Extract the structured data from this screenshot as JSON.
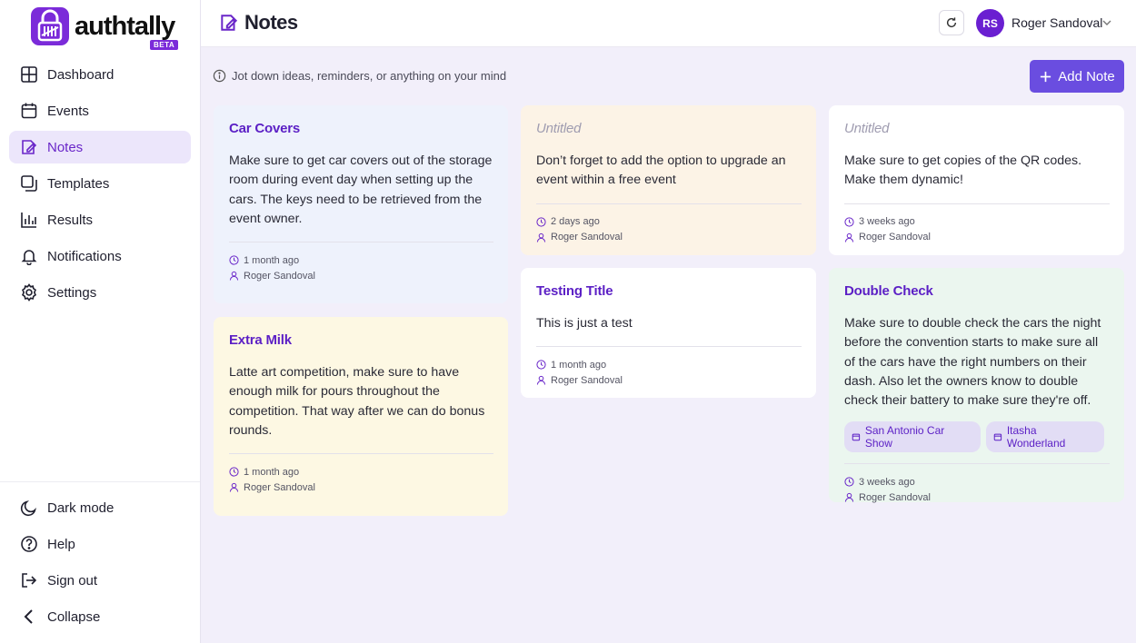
{
  "brand": {
    "name": "authtally",
    "badge": "BETA"
  },
  "nav": {
    "items": [
      {
        "label": "Dashboard",
        "icon": "dashboard-icon"
      },
      {
        "label": "Events",
        "icon": "calendar-icon"
      },
      {
        "label": "Notes",
        "icon": "note-icon",
        "active": true
      },
      {
        "label": "Templates",
        "icon": "templates-icon"
      },
      {
        "label": "Results",
        "icon": "chart-icon"
      },
      {
        "label": "Notifications",
        "icon": "bell-icon"
      },
      {
        "label": "Settings",
        "icon": "gear-icon"
      }
    ],
    "bottom": [
      {
        "label": "Dark mode",
        "icon": "moon-icon"
      },
      {
        "label": "Help",
        "icon": "help-icon"
      },
      {
        "label": "Sign out",
        "icon": "sign-out-icon"
      },
      {
        "label": "Collapse",
        "icon": "chevron-left-icon"
      }
    ]
  },
  "header": {
    "title": "Notes",
    "user": {
      "initials": "RS",
      "name": "Roger Sandoval"
    }
  },
  "info": {
    "text": "Jot down ideas, reminders, or anything on your mind"
  },
  "add_button": {
    "label": "Add Note"
  },
  "colors": {
    "accent": "#6a4de0",
    "brand": "#7b2bd9",
    "title": "#5b1fc5",
    "blue": "#eef2fc",
    "yellow": "#fdf8e3",
    "peach": "#fcf3e6",
    "white": "#ffffff",
    "green": "#ebf6ef"
  },
  "notes": [
    {
      "title": "Car Covers",
      "body": "Make sure to get car covers out of the storage room during event day when setting up the cars. The keys need to be retrieved from the event owner.",
      "time": "1 month ago",
      "author": "Roger Sandoval"
    },
    {
      "title": "Extra Milk",
      "body": "Latte art competition, make sure to have enough milk for pours throughout the competition. That way after we can do bonus rounds.",
      "time": "1 month ago",
      "author": "Roger Sandoval"
    },
    {
      "title": "Untitled",
      "body": "Don’t forget to add the option to upgrade an event within a free event",
      "time": "2 days ago",
      "author": "Roger Sandoval"
    },
    {
      "title": "Testing Title",
      "body": "This is just a test",
      "time": "1 month ago",
      "author": "Roger Sandoval"
    },
    {
      "title": "Untitled",
      "body": "Make sure to get copies of the QR codes. Make them dynamic!",
      "time": "3 weeks ago",
      "author": "Roger Sandoval"
    },
    {
      "title": "Double Check",
      "body": "Make sure to double check the cars the night before the convention starts to make sure all of the cars have the right numbers on their dash. Also let the owners know to double check their battery to make sure they're off.",
      "tags": [
        "San Antonio Car Show",
        "Itasha Wonderland"
      ],
      "time": "3 weeks ago",
      "author": "Roger Sandoval"
    }
  ]
}
